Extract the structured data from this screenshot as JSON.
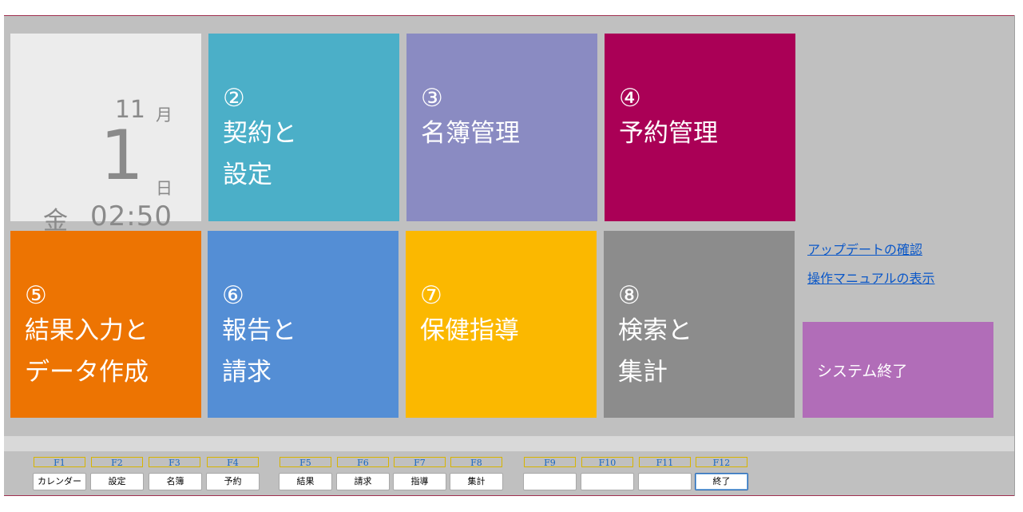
{
  "clock": {
    "month": "11",
    "month_unit": "月",
    "day": "1",
    "day_unit": "日",
    "weekday": "金",
    "time": "02:50"
  },
  "tiles": [
    {
      "num": "②",
      "label": "契約と\n設定",
      "color": "#4bafc8"
    },
    {
      "num": "③",
      "label": "名簿管理",
      "color": "#8a8bc2"
    },
    {
      "num": "④",
      "label": "予約管理",
      "color": "#aa0056"
    },
    {
      "num": "⑤",
      "label": "結果入力と\nデータ作成",
      "color": "#ed7402"
    },
    {
      "num": "⑥",
      "label": "報告と\n請求",
      "color": "#548ed5"
    },
    {
      "num": "⑦",
      "label": "保健指導",
      "color": "#fbb800"
    },
    {
      "num": "⑧",
      "label": "検索と\n集計",
      "color": "#8c8c8c"
    }
  ],
  "links": {
    "update": "アップデートの確認",
    "manual": "操作マニュアルの表示"
  },
  "system_exit": "システム終了",
  "fkeys": [
    {
      "key": "F1",
      "label": "カレンダー"
    },
    {
      "key": "F2",
      "label": "設定"
    },
    {
      "key": "F3",
      "label": "名簿"
    },
    {
      "key": "F4",
      "label": "予約"
    },
    {
      "key": "F5",
      "label": "結果"
    },
    {
      "key": "F6",
      "label": "請求"
    },
    {
      "key": "F7",
      "label": "指導"
    },
    {
      "key": "F8",
      "label": "集計"
    },
    {
      "key": "F9",
      "label": ""
    },
    {
      "key": "F10",
      "label": ""
    },
    {
      "key": "F11",
      "label": ""
    },
    {
      "key": "F12",
      "label": "終了"
    }
  ]
}
